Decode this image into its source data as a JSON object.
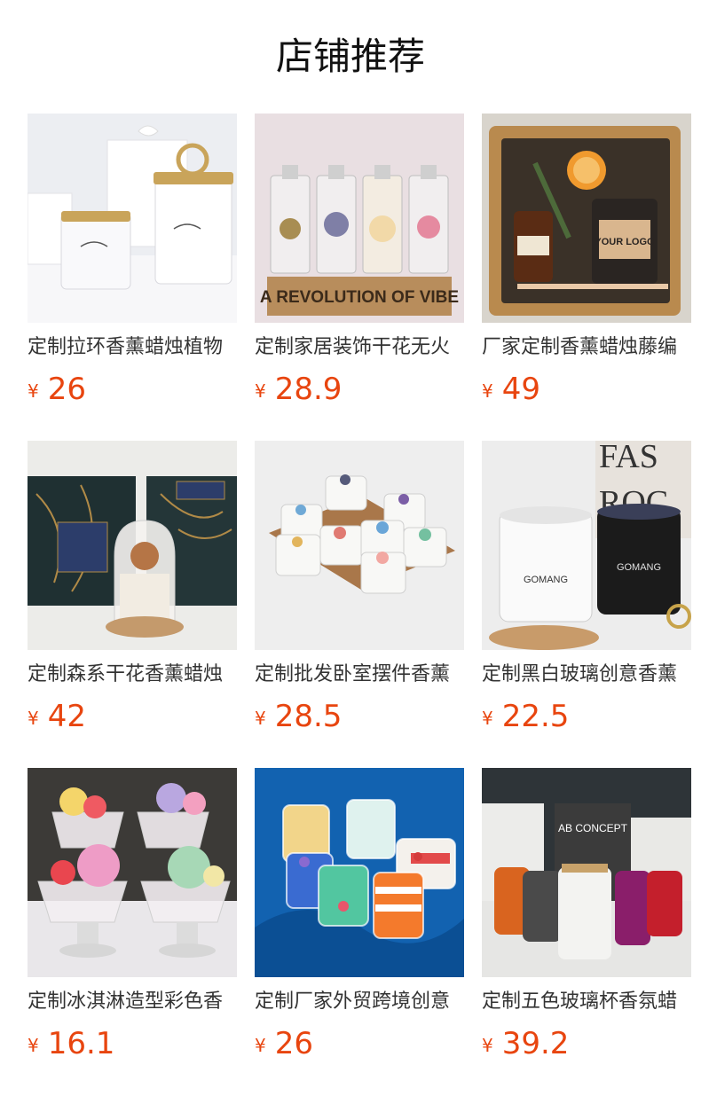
{
  "header": {
    "title": "店铺推荐"
  },
  "currency_symbol": "¥",
  "products": [
    {
      "name": "定制拉环香薰蜡烛植物",
      "price": "26",
      "image": "white-candle-jars-with-gold-ring-lid"
    },
    {
      "name": "定制家居装饰干花无火",
      "price": "28.9",
      "image": "reed-diffuser-bottles-with-dried-flowers",
      "image_text": "A REVOLUTION OF VIBE"
    },
    {
      "name": "厂家定制香薰蜡烛藤编",
      "price": "49",
      "image": "rattan-basket-gift-set-with-candle",
      "image_text": "YOUR LOGO"
    },
    {
      "name": "定制森系干花香薰蜡烛",
      "price": "42",
      "image": "glass-dome-candle-with-gift-box"
    },
    {
      "name": "定制批发卧室摆件香薰",
      "price": "28.5",
      "image": "crystal-topped-candles-on-wood-tray"
    },
    {
      "name": "定制黑白玻璃创意香薰",
      "price": "22.5",
      "image": "black-and-white-glass-candles",
      "image_text": "GOMANG"
    },
    {
      "name": "定制冰淇淋造型彩色香",
      "price": "16.1",
      "image": "ice-cream-shaped-candles-in-glass-cups"
    },
    {
      "name": "定制厂家外贸跨境创意",
      "price": "26",
      "image": "colorful-candles-on-blue-fabric"
    },
    {
      "name": "定制五色玻璃杯香氛蜡",
      "price": "39.2",
      "image": "five-color-glass-jar-candles",
      "image_text": "AB CONCEPT"
    }
  ]
}
